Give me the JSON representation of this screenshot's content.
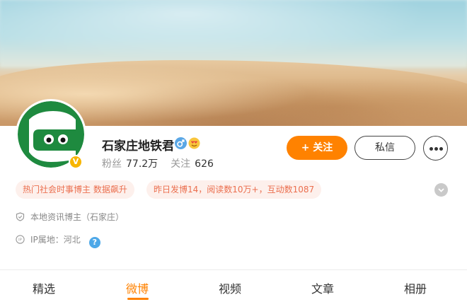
{
  "profile": {
    "name": "石家庄地铁君",
    "verified_badge": "V",
    "fans_label": "粉丝",
    "fans_count": "77.2万",
    "following_label": "关注",
    "following_count": "626",
    "avatar_icon": "subway-face-logo",
    "gender_icon": "male-icon",
    "emoji_icon": "heart-eyes-icon"
  },
  "actions": {
    "follow_label": "+ 关注",
    "message_label": "私信",
    "more_icon": "more-dots-icon"
  },
  "tags": [
    "热门社会时事博主 数据飙升",
    "昨日发博14，阅读数10万+，互动数1087"
  ],
  "info": {
    "blogger_type": "本地资讯博主（石家庄）",
    "ip_location": "IP属地：河北",
    "help_icon": "?"
  },
  "tabs": [
    "精选",
    "微博",
    "视频",
    "文章",
    "相册"
  ],
  "active_tab": "微博",
  "colors": {
    "accent": "#ff8200",
    "tag_bg": "#fdf0ec",
    "tag_text": "#eb6f4f",
    "avatar_green": "#1e8a3f",
    "verified": "#f7b500"
  }
}
